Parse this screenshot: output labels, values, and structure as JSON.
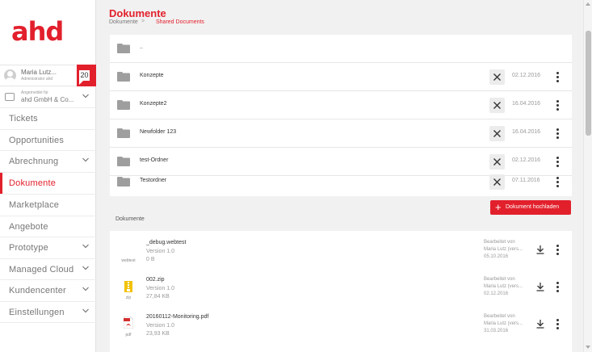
{
  "sidebar": {
    "logo_text": "ahd",
    "user": {
      "name": "Maria Lutz...",
      "subtitle": "Administrator ahd"
    },
    "notifications": {
      "count": "20"
    },
    "company": {
      "small_label": "Angemeldet für",
      "name": "ahd GmbH & Co..."
    },
    "items": [
      {
        "label": "Tickets"
      },
      {
        "label": "Opportunities"
      },
      {
        "label": "Abrechnung"
      },
      {
        "label": "Dokumente"
      },
      {
        "label": "Marketplace"
      },
      {
        "label": "Angebote"
      },
      {
        "label": "Prototype"
      },
      {
        "label": "Managed Cloud"
      },
      {
        "label": "Kundencenter"
      },
      {
        "label": "Einstellungen"
      }
    ]
  },
  "header": {
    "title": "Dokumente",
    "breadcrumb": [
      "Dokumente",
      "Shared Documents"
    ],
    "breadcrumb_sep": ">"
  },
  "folders": [
    {
      "name": "..",
      "date": ""
    },
    {
      "name": "Konzepte",
      "date": "02.12.2016"
    },
    {
      "name": "Konzepte2",
      "date": "16.04.2016"
    },
    {
      "name": "Newfolder 123",
      "date": "16.04.2016"
    },
    {
      "name": "test-Ordner",
      "date": "02.12.2016"
    },
    {
      "name": "Testordner",
      "date": "07.11.2016"
    }
  ],
  "upload_button": {
    "icon": "+",
    "label": "Dokument hochladen"
  },
  "documents_title": "Dokumente",
  "documents": [
    {
      "name": "_debug.webtest",
      "version": "Version 1.0",
      "size": "0 B",
      "type_label": "webtest",
      "edited_label": "Bearbeitet von",
      "edited_by": "Maria Lutz (vers...",
      "edited_date": "05.10.2016"
    },
    {
      "name": "002.zip",
      "version": "Version 1.0",
      "size": "27,84 KB",
      "type_label": "zip",
      "edited_label": "Bearbeitet von",
      "edited_by": "Maria Lutz (vers...",
      "edited_date": "02.12.2016"
    },
    {
      "name": "20160112-Monitoring.pdf",
      "version": "Version 1.0",
      "size": "23,93 KB",
      "type_label": "pdf",
      "edited_label": "Bearbeitet von",
      "edited_by": "Maria Lutz (vers...",
      "edited_date": "31.03.2016"
    }
  ],
  "colors": {
    "accent": "#e2202c",
    "folder": "#9e9e9e"
  }
}
